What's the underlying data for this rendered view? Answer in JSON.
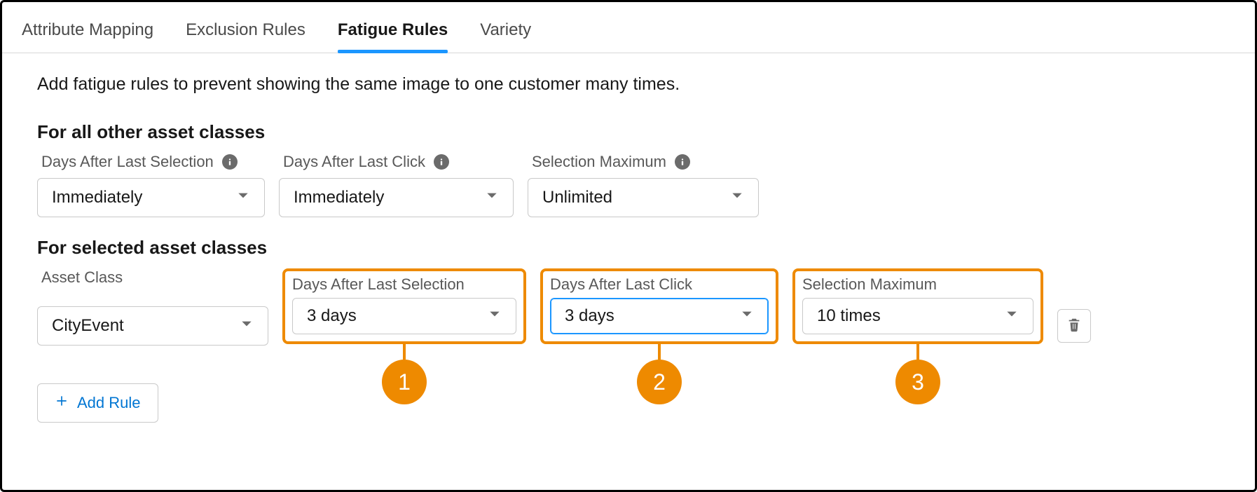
{
  "tabs": {
    "attribute_mapping": "Attribute Mapping",
    "exclusion_rules": "Exclusion Rules",
    "fatigue_rules": "Fatigue Rules",
    "variety": "Variety"
  },
  "intro": "Add fatigue rules to prevent showing the same image to one customer many times.",
  "sections": {
    "all_other": {
      "heading": "For all other asset classes",
      "fields": {
        "days_after_selection": {
          "label": "Days After Last Selection",
          "value": "Immediately"
        },
        "days_after_click": {
          "label": "Days After Last Click",
          "value": "Immediately"
        },
        "selection_max": {
          "label": "Selection Maximum",
          "value": "Unlimited"
        }
      }
    },
    "selected": {
      "heading": "For selected asset classes",
      "asset_class": {
        "label": "Asset Class",
        "value": "CityEvent"
      },
      "fields": {
        "days_after_selection": {
          "label": "Days After Last Selection",
          "value": "3 days",
          "badge": "1"
        },
        "days_after_click": {
          "label": "Days After Last Click",
          "value": "3 days",
          "badge": "2"
        },
        "selection_max": {
          "label": "Selection Maximum",
          "value": "10 times",
          "badge": "3"
        }
      }
    }
  },
  "buttons": {
    "add_rule": "Add Rule"
  }
}
